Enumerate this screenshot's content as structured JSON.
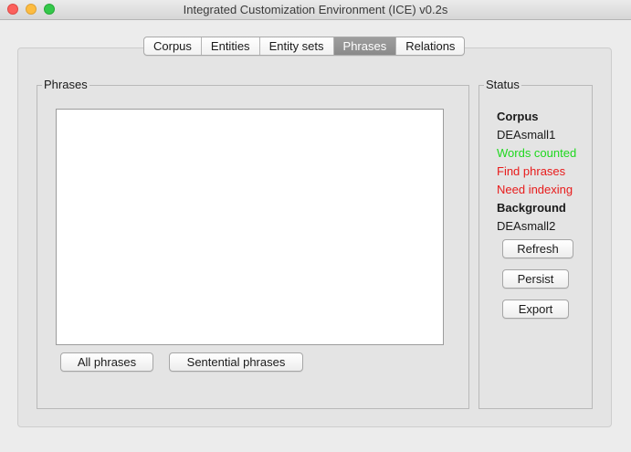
{
  "window": {
    "title": "Integrated Customization Environment (ICE) v0.2s"
  },
  "tabs": [
    {
      "label": "Corpus"
    },
    {
      "label": "Entities"
    },
    {
      "label": "Entity sets"
    },
    {
      "label": "Phrases",
      "active": true
    },
    {
      "label": "Relations"
    }
  ],
  "phrases_panel": {
    "title": "Phrases",
    "items": [],
    "all_button": "All phrases",
    "sentential_button": "Sentential phrases"
  },
  "status_panel": {
    "title": "Status",
    "corpus_heading": "Corpus",
    "corpus_name": "DEAsmall1",
    "words_counted": "Words counted",
    "find_phrases": "Find phrases",
    "need_indexing": "Need indexing",
    "background_heading": "Background",
    "background_name": "DEAsmall2",
    "refresh_button": "Refresh",
    "persist_button": "Persist",
    "export_button": "Export"
  },
  "colors": {
    "status_ok": "#1ed81e",
    "status_todo": "#e81b1b",
    "active_tab": "#8e8e8e"
  }
}
